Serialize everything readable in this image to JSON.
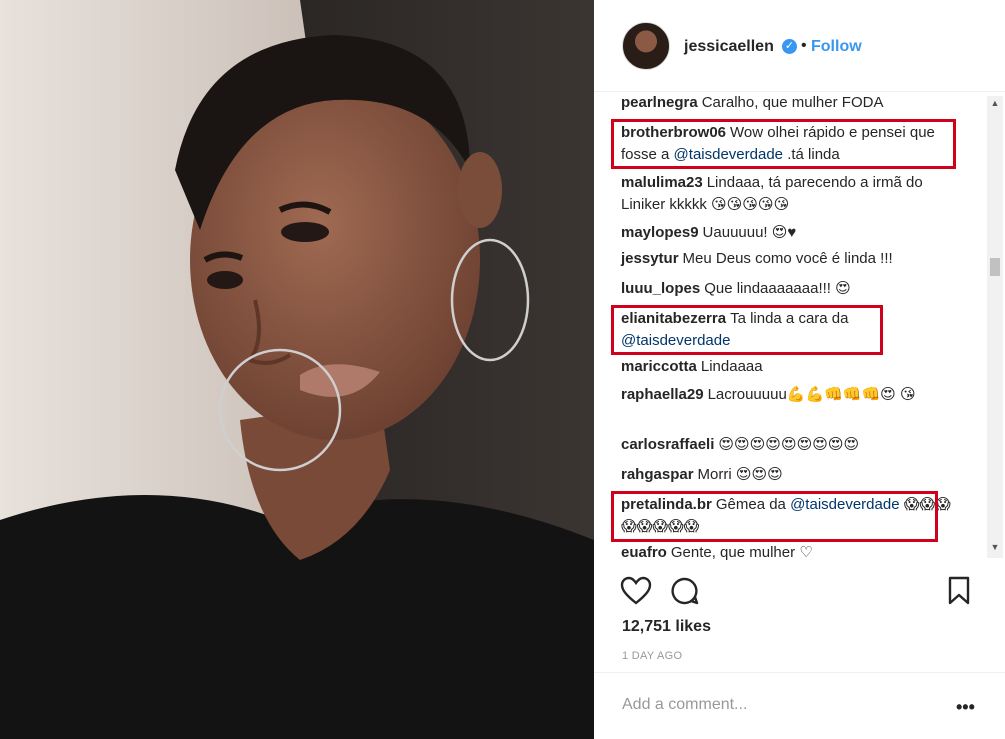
{
  "post": {
    "username": "jessicaellen",
    "follow_label": "Follow",
    "likes": "12,751 likes",
    "timestamp": "1 DAY AGO",
    "add_comment_placeholder": "Add a comment...",
    "more_label": "•••"
  },
  "comments": [
    {
      "user": "pearlnegra",
      "text": "Caralho, que mulher FODA"
    },
    {
      "user": "brotherbrow06",
      "text": "Wow olhei rápido e pensei que fosse a",
      "mention": "@taisdeverdade",
      "after": ".tá linda"
    },
    {
      "user": "malulima23",
      "text": "Lindaaa, tá parecendo a irmã do Liniker kkkkk 😘😘😘😘😘"
    },
    {
      "user": "maylopes9",
      "text": "Uauuuuu! 😍♥"
    },
    {
      "user": "jessytur",
      "text": "Meu Deus como você é linda !!!"
    },
    {
      "user": "luuu_lopes",
      "text": "Que lindaaaaaaa!!! 😍"
    },
    {
      "user": "elianitabezerra",
      "text": "Ta linda a cara da",
      "mention": "@taisdeverdade"
    },
    {
      "user": "mariccotta",
      "text": "Lindaaaa"
    },
    {
      "user": "raphaella29",
      "text": "Lacrouuuuu💪💪👊👊👊😍 😘"
    },
    {
      "user": "carlosraffaeli",
      "text": "😍😍😍😍😍😍😍😍😍"
    },
    {
      "user": "rahgaspar",
      "text": "Morri 😍😍😍"
    },
    {
      "user": "pretalinda.br",
      "text": "Gêmea da",
      "mention": "@taisdeverdade",
      "after": "😱😱😱😱😱😱😱😱"
    },
    {
      "user": "euafro",
      "text": "Gente, que mulher ♡"
    }
  ],
  "colors": {
    "accent": "#3897f0",
    "highlight": "#d0021b",
    "mention": "#003569"
  }
}
